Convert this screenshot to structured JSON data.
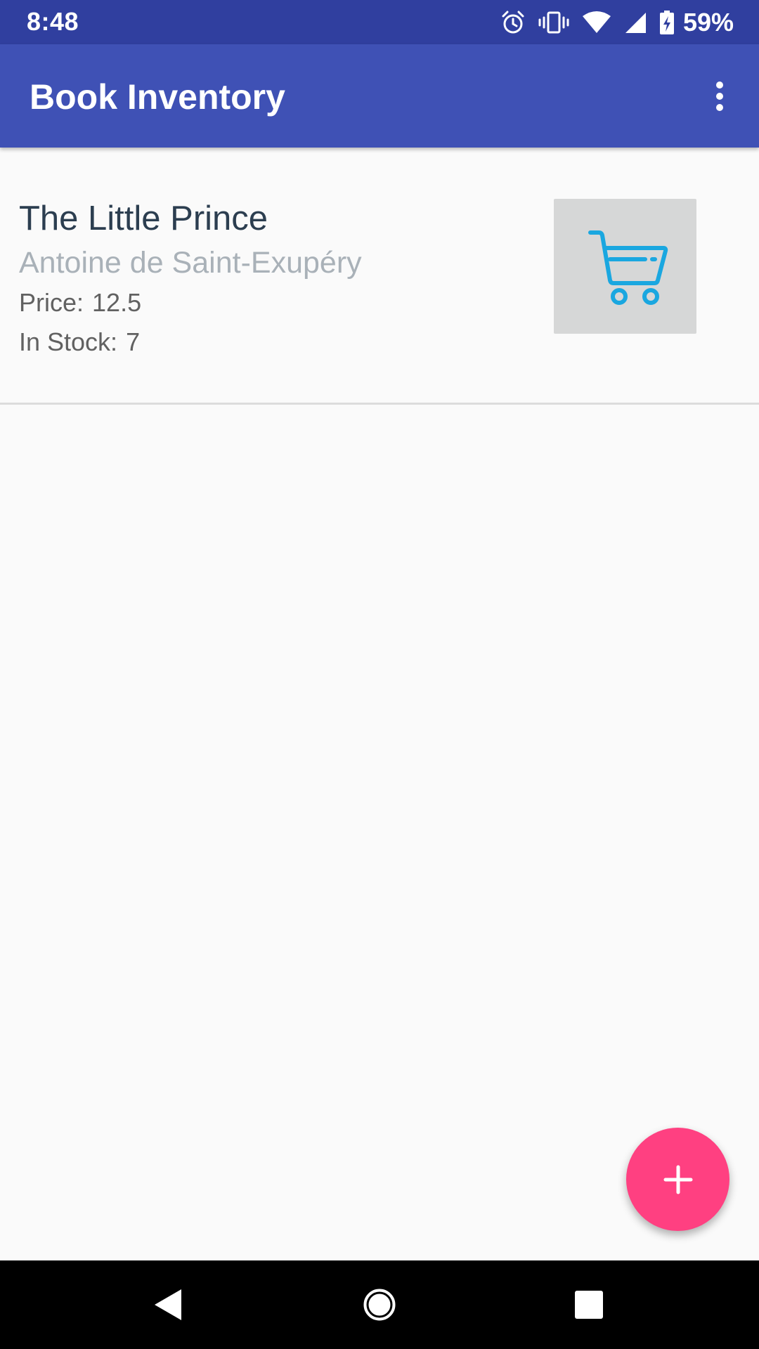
{
  "status_bar": {
    "time": "8:48",
    "battery_percent": "59%",
    "icons": [
      "alarm-icon",
      "vibrate-icon",
      "wifi-icon",
      "cell-signal-icon",
      "battery-charging-icon"
    ]
  },
  "app_bar": {
    "title": "Book Inventory",
    "menu_icon": "more-vert-icon"
  },
  "books": [
    {
      "title": "The Little Prince",
      "author": "Antoine de Saint-Exupéry",
      "price_label": "Price:",
      "price": "12.5",
      "stock_label": "In Stock:",
      "stock": "7",
      "action_icon": "shopping-cart-icon"
    }
  ],
  "fab": {
    "icon": "plus-icon"
  },
  "nav_bar": {
    "icons": [
      "back-icon",
      "home-icon",
      "recents-icon"
    ]
  },
  "colors": {
    "status_bar": "#303f9f",
    "app_bar": "#3f51b5",
    "fab": "#ff4081",
    "cart_icon": "#1aa7e0",
    "cart_button_bg": "#d6d7d7",
    "title_text": "#2c3e50",
    "author_text": "#a9b1b8"
  }
}
